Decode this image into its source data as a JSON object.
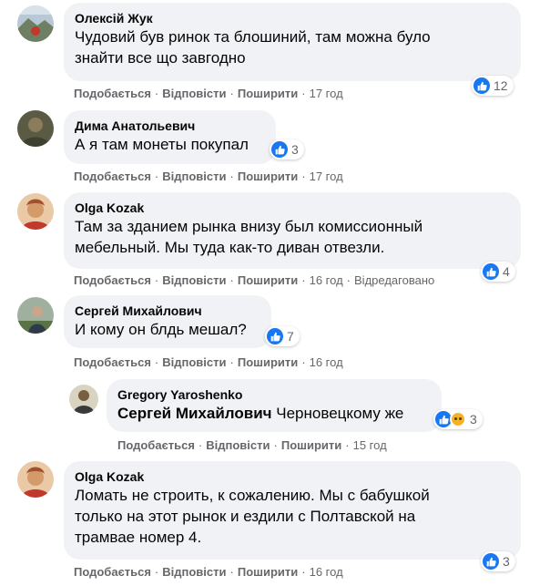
{
  "actions": {
    "like": "Подобається",
    "reply": "Відповісти",
    "share": "Поширити",
    "sep": "·"
  },
  "colors": {
    "bubble": "#f0f2f5",
    "like": "#1877f2",
    "meta": "#65676b"
  },
  "comments": [
    {
      "author": "Олексій Жук",
      "text": [
        "Чудовий був ринок та блошиний, там можна було",
        "знайти все що завгодно"
      ],
      "reactions": "12",
      "time": "17 год"
    },
    {
      "author": "Дима Анатольевич",
      "text": [
        "А я там монеты покупал"
      ],
      "reactions": "3",
      "time": "17 год"
    },
    {
      "author": "Olga Kozak",
      "text": [
        "Там за зданием рынка внизу был комиссионный",
        "мебельный. Мы туда как-то диван отвезли."
      ],
      "reactions": "4",
      "time": "16 год",
      "edited": "Відредаговано"
    },
    {
      "author": "Сергей Михайлович",
      "text": [
        "И кому он блдь мешал?"
      ],
      "reactions": "7",
      "time": "16 год"
    },
    {
      "author": "Gregory Yaroshenko",
      "mention": "Сергей Михайлович",
      "text": [
        "Черновецкому же"
      ],
      "reactions": "3",
      "time": "15 год"
    },
    {
      "author": "Olga Kozak",
      "text": [
        "Ломать не строить, к сожалению. Мы с бабушкой",
        "только на этот рынок и ездили с Полтавской на",
        "трамвае номер 4."
      ],
      "reactions": "3",
      "time": "16 год"
    }
  ]
}
